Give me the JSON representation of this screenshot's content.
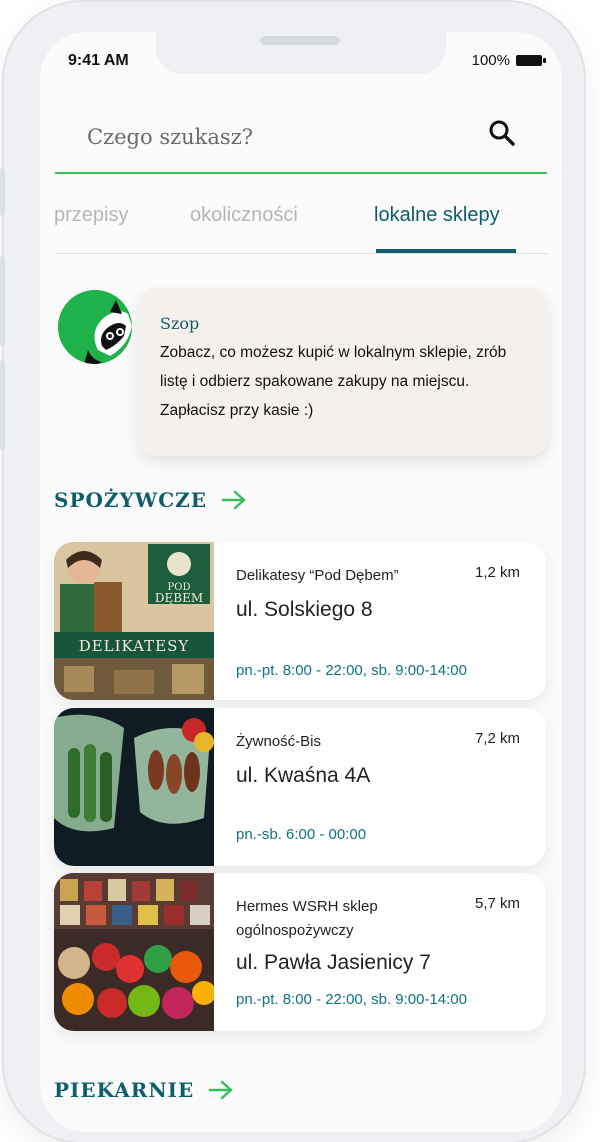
{
  "status": {
    "time": "9:41 AM",
    "battery": "100%"
  },
  "search": {
    "placeholder": "Czego szukasz?"
  },
  "tabs": [
    {
      "label": "przepisy"
    },
    {
      "label": "okoliczności"
    },
    {
      "label": "lokalne sklepy"
    }
  ],
  "active_tab": "lokalne sklepy",
  "message": {
    "author": "Szop",
    "text": "Zobacz, co możesz kupić w lokalnym sklepie, zrób listę i odbierz spakowane zakupy na miejscu. Zapłacisz przy kasie :)"
  },
  "sections": [
    {
      "title": "SPOŻYWCZE"
    },
    {
      "title": "PIEKARNIE"
    }
  ],
  "shops": [
    {
      "name": "Delikatesy “Pod Dębem”",
      "distance": "1,2 km",
      "street": "ul. Solskiego 8",
      "hours": "pn.-pt. 8:00 - 22:00, sb. 9:00-14:00",
      "image": {
        "brand_top": "POD",
        "brand_bottom": "DĘBEM",
        "banner": "DELIKATESY"
      }
    },
    {
      "name": "Żywność-Bis",
      "distance": "7,2 km",
      "street": "ul. Kwaśna 4A",
      "hours": "pn.-sb. 6:00 - 00:00"
    },
    {
      "name": "Hermes WSRH sklep ogólnospożywczy",
      "distance": "5,7 km",
      "street": "ul. Pawła Jasienicy 7",
      "hours": "pn.-pt. 8:00 - 22:00, sb. 9:00-14:00"
    }
  ],
  "colors": {
    "accent": "#0e5d6a",
    "green": "#35c05c",
    "hours": "#0e7480",
    "bubble": "#f6f0ec"
  },
  "icons": [
    "search-icon",
    "raccoon-avatar",
    "arrow-right-icon",
    "battery-icon"
  ]
}
